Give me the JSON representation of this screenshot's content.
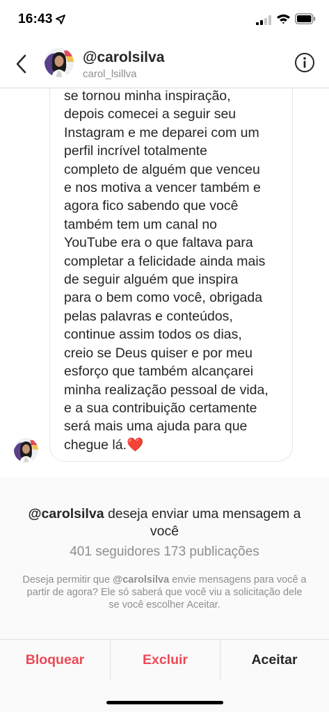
{
  "status_bar": {
    "time": "16:43",
    "icons": [
      "location-arrow-icon",
      "cellular-signal-icon",
      "wifi-icon",
      "battery-icon"
    ]
  },
  "header": {
    "username": "@carolsilva",
    "subname": "carol_lsillva",
    "icons": [
      "back-chevron-icon",
      "info-icon"
    ]
  },
  "message": {
    "lines": [
      "se tornou minha inspiração,",
      "depois comecei a seguir seu",
      "Instagram e me deparei com um",
      "perfil incrível totalmente",
      "completo de alguém que venceu",
      "e nos motiva a vencer também e",
      "agora fico sabendo que você",
      "também tem um canal no",
      "YouTube era o que faltava para",
      "completar a felicidade ainda mais",
      "de seguir alguém que inspira",
      "para o bem como você, obrigada",
      "pelas palavras e conteúdos,",
      "continue assim todos os dias,",
      "creio se Deus quiser e por meu",
      "esforço que também alcançarei",
      "minha realização pessoal de vida,",
      "e a sua contribuição certamente",
      "será mais uma ajuda para que"
    ],
    "last_line": "chegue lá.",
    "emoji": "❤️"
  },
  "request": {
    "username": "@carolsilva",
    "title_rest": " deseja enviar uma mensagem a você",
    "stats": "401 seguidores 173 publicações",
    "note_prefix": "Deseja permitir que ",
    "note_username": "@carolsilva",
    "note_suffix": " envie mensagens para você a partir de agora? Ele só saberá que você viu a solicitação dele se você escolher Aceitar."
  },
  "actions": {
    "block": "Bloquear",
    "delete": "Excluir",
    "accept": "Aceitar"
  },
  "colors": {
    "destructive": "#ed4956",
    "text": "#262626",
    "muted": "#8e8e8e",
    "panel_bg": "#fafafa",
    "heart": "#ed1c24"
  }
}
